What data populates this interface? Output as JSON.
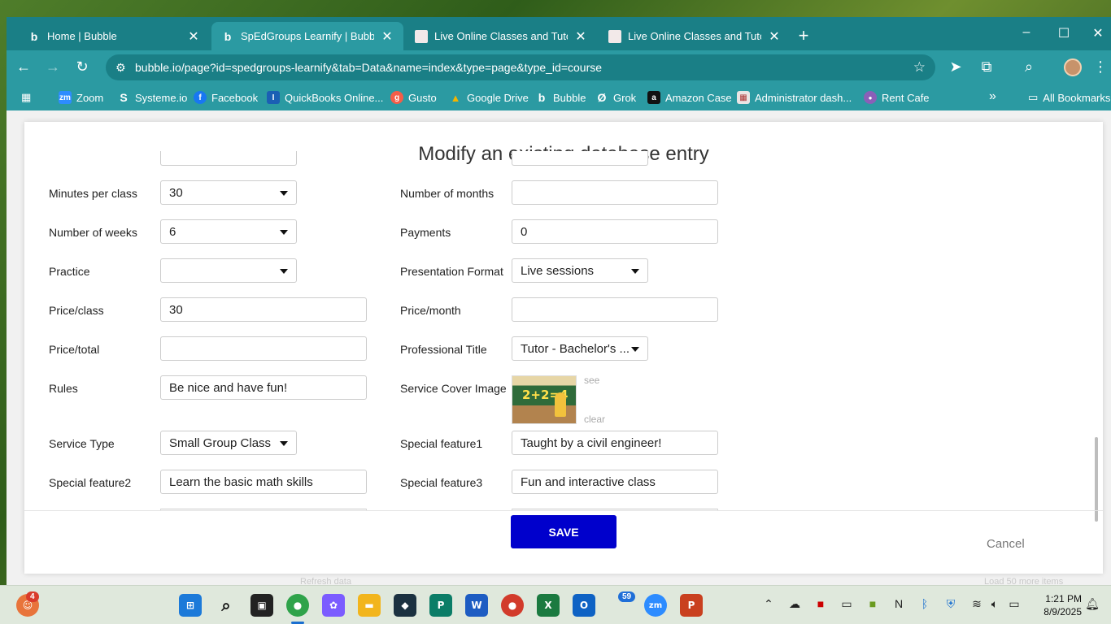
{
  "browser": {
    "tabs": [
      {
        "title": "Home | Bubble",
        "favicon": "bubble-icon"
      },
      {
        "title": "SpEdGroups Learnify | Bubble E",
        "favicon": "bubble-icon"
      },
      {
        "title": "Live Online Classes and Tutoring",
        "favicon": "outschool-icon"
      },
      {
        "title": "Live Online Classes and Tutoring",
        "favicon": "outschool-icon"
      }
    ],
    "active_tab": 1,
    "url": "bubble.io/page?id=spedgroups-learnify&tab=Data&name=index&type=page&type_id=course",
    "bookmarks": [
      {
        "label": "Zoom",
        "icon": "zoom-icon",
        "color": "#2d8cff",
        "glyph": "zm"
      },
      {
        "label": "Systeme.io",
        "icon": "systeme-icon",
        "color": "#1f4e8c",
        "glyph": "S"
      },
      {
        "label": "Facebook",
        "icon": "facebook-icon",
        "color": "#1877f2",
        "glyph": "f"
      },
      {
        "label": "QuickBooks Online...",
        "icon": "quickbooks-icon",
        "color": "#1b5fb4",
        "glyph": "I"
      },
      {
        "label": "Gusto",
        "icon": "gusto-icon",
        "color": "#f45d48",
        "glyph": "g"
      },
      {
        "label": "Google Drive",
        "icon": "google-drive-icon",
        "color": "#f4b400",
        "glyph": "▲"
      },
      {
        "label": "Bubble",
        "icon": "bubble-icon",
        "color": "#1a7f86",
        "glyph": "b"
      },
      {
        "label": "Grok",
        "icon": "grok-icon",
        "color": "#1a7f86",
        "glyph": "Ø"
      },
      {
        "label": "Amazon Case",
        "icon": "amazon-icon",
        "color": "#111111",
        "glyph": "a"
      },
      {
        "label": "Administrator dash...",
        "icon": "admin-icon",
        "color": "#e9e4e4",
        "glyph": "▦"
      },
      {
        "label": "Rent Cafe",
        "icon": "rentcafe-icon",
        "color": "#8a5fb8",
        "glyph": "●"
      }
    ],
    "all_bookmarks_label": "All Bookmarks"
  },
  "modal": {
    "title": "Modify an existing database entry",
    "fields": {
      "minutes_per_class": {
        "label": "Minutes per class",
        "value": "30"
      },
      "number_of_weeks": {
        "label": "Number of weeks",
        "value": "6"
      },
      "practice": {
        "label": "Practice",
        "value": ""
      },
      "price_class": {
        "label": "Price/class",
        "value": "30"
      },
      "price_total": {
        "label": "Price/total",
        "value": ""
      },
      "rules": {
        "label": "Rules",
        "value": "Be nice and have fun!"
      },
      "service_type": {
        "label": "Service Type",
        "value": "Small Group Class"
      },
      "special_feature2": {
        "label": "Special feature2",
        "value": "Learn the basic math skills"
      },
      "number_of_months": {
        "label": "Number of months",
        "value": ""
      },
      "payments": {
        "label": "Payments",
        "value": "0"
      },
      "presentation_format": {
        "label": "Presentation Format",
        "value": "Live sessions"
      },
      "price_month": {
        "label": "Price/month",
        "value": ""
      },
      "professional_title": {
        "label": "Professional Title",
        "value": "Tutor - Bachelor's ..."
      },
      "service_cover_image": {
        "label": "Service Cover Image",
        "see": "see",
        "clear": "clear",
        "thumb_text": "2+2=4"
      },
      "special_feature1": {
        "label": "Special feature1",
        "value": "Taught by a civil engineer!"
      },
      "special_feature3": {
        "label": "Special feature3",
        "value": "Fun and interactive class"
      }
    },
    "save_label": "SAVE",
    "cancel_label": "Cancel",
    "refresh_label": "Refresh data",
    "load_more_label": "Load 50 more items"
  },
  "taskbar": {
    "chat_badge": "4",
    "outlook_badge": "59",
    "time": "1:21 PM",
    "date": "8/9/2025"
  }
}
